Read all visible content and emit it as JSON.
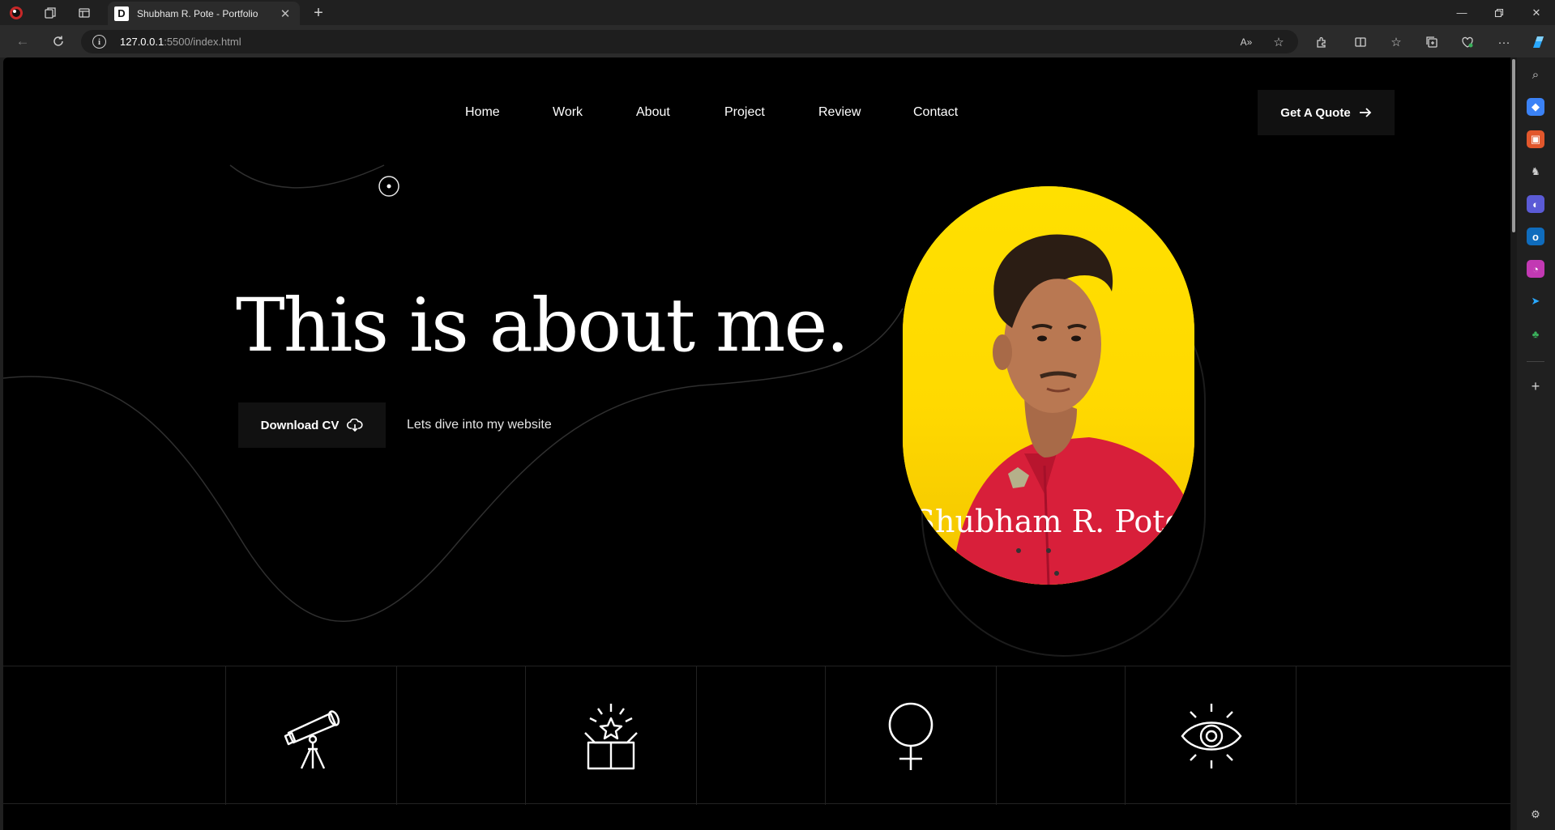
{
  "browser": {
    "tab_title": "Shubham R. Pote - Portfolio",
    "tab_favicon": "D",
    "address_host": "127.0.0.1",
    "address_path": ":5500/index.html",
    "window_controls": [
      "minimize-icon",
      "restore-icon",
      "close-icon"
    ],
    "sidebar_icons": [
      "search-icon",
      "tag-icon",
      "briefcase-icon",
      "chess-icon",
      "copilot-icon",
      "outlook-icon",
      "designer-icon",
      "send-icon",
      "tree-icon",
      "add-icon",
      "settings-icon"
    ]
  },
  "nav": {
    "links": [
      "Home",
      "Work",
      "About",
      "Project",
      "Review",
      "Contact"
    ],
    "cta": "Get A Quote"
  },
  "hero": {
    "title": "This is about me.",
    "cv_button": "Download CV",
    "tagline": "Lets dive into my website",
    "portrait_name": "Shubham R. Pote",
    "portrait_bg": "#ffe000"
  },
  "features": {
    "icons": [
      "telescope-icon",
      "gift-box-icon",
      "female-symbol-icon",
      "eye-icon"
    ]
  },
  "colors": {
    "page_bg": "#000000",
    "button_bg": "#111111",
    "accent": "#ffe000"
  }
}
